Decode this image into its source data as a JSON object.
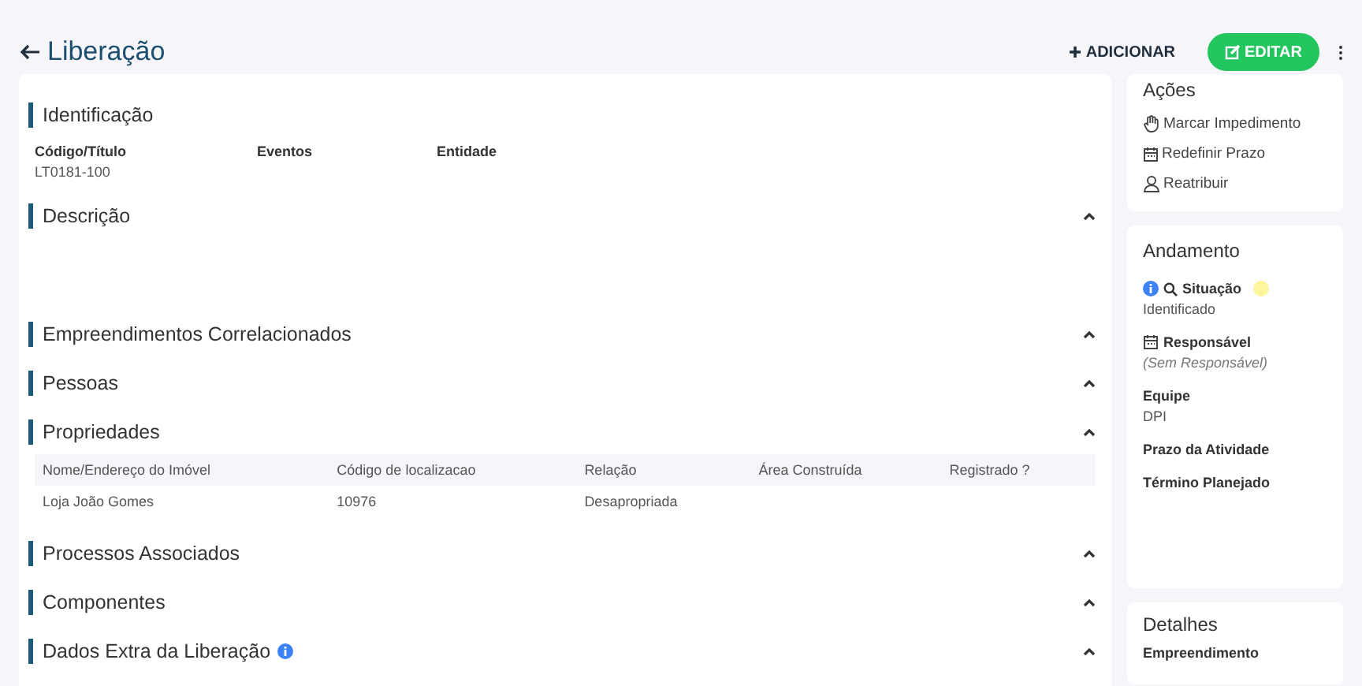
{
  "header": {
    "title": "Liberação",
    "add_label": "ADICIONAR",
    "edit_label": "EDITAR"
  },
  "sections": [
    {
      "title": "Identificação",
      "kind": "fields",
      "fields": [
        {
          "label": "Código/Título",
          "value": "LT0181-100"
        },
        {
          "label": "Eventos"
        },
        {
          "label": "Entidade"
        }
      ]
    },
    {
      "title": "Descrição",
      "kind": "blank",
      "expanded": true
    },
    {
      "title": "Empreendimentos Correlacionados",
      "kind": "plain",
      "expanded": true
    },
    {
      "title": "Pessoas",
      "kind": "plain",
      "expanded": true
    },
    {
      "title": "Propriedades",
      "kind": "table",
      "expanded": true,
      "columns": [
        "Nome/Endereço do Imóvel",
        "Código de localizacao",
        "Relação",
        "Área Construída",
        "Registrado ?"
      ],
      "rows": [
        [
          "Loja João Gomes",
          "10976",
          "Desapropriada"
        ]
      ]
    },
    {
      "title": "Processos Associados",
      "kind": "plain",
      "expanded": true
    },
    {
      "title": "Componentes",
      "kind": "plain",
      "expanded": true
    },
    {
      "title": "Dados Extra da Liberação",
      "kind": "plain",
      "expanded": true,
      "info": true
    }
  ],
  "actions": {
    "title": "Ações",
    "items": [
      {
        "label": "Marcar Impedimento"
      },
      {
        "label": "Redefinir Prazo"
      },
      {
        "label": "Reatribuir"
      }
    ]
  },
  "progress": {
    "title": "Andamento",
    "fields": [
      {
        "kind": "status",
        "label": "Situação",
        "value": "Identificado",
        "color": "#fff59d"
      },
      {
        "kind": "dated",
        "label": "Responsável",
        "value": "(Sem Responsável)",
        "empty": true
      },
      {
        "kind": "plain",
        "label": "Equipe",
        "value": "DPI"
      },
      {
        "kind": "plain",
        "label": "Prazo da Atividade"
      },
      {
        "kind": "plain",
        "label": "Término Planejado"
      }
    ]
  },
  "details": {
    "title": "Detalhes",
    "fields": [
      {
        "label": "Empreendimento"
      }
    ]
  }
}
